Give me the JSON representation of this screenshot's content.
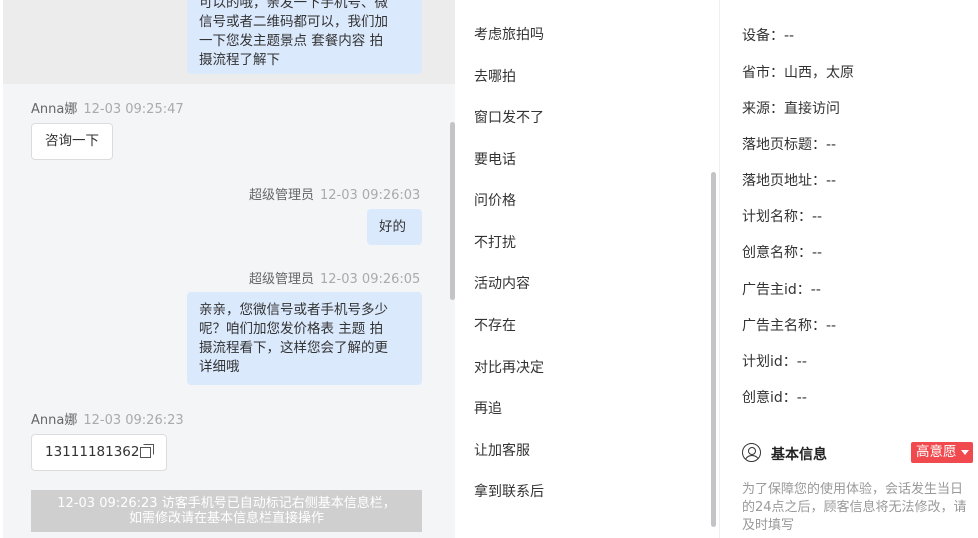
{
  "chat": {
    "messages": [
      {
        "role": "agent",
        "lines": [
          "可以的哦，亲发一下手机号、微",
          "信号或者二维码都可以，我们加",
          "一下您发主题景点 套餐内容 拍",
          "摄流程了解下"
        ]
      },
      {
        "role": "visitor",
        "name": "Anna娜",
        "time": "12-03 09:25:47",
        "text": "咨询一下"
      },
      {
        "role": "agent",
        "name": "超级管理员",
        "time": "12-03 09:26:03",
        "lines": [
          "好的"
        ]
      },
      {
        "role": "agent",
        "name": "超级管理员",
        "time": "12-03 09:26:05",
        "lines": [
          "亲亲，您微信号或者手机号多少",
          "呢？咱们加您发价格表 主题 拍",
          "摄流程看下，这样您会了解的更",
          "详细哦"
        ]
      },
      {
        "role": "visitor",
        "name": "Anna娜",
        "time": "12-03 09:26:23",
        "text": "13111181362"
      }
    ],
    "system_notice": [
      "12-03 09:26:23 访客手机号已自动标记右侧基本信息栏，",
      "如需修改请在基本信息栏直接操作"
    ]
  },
  "quick_phrases": [
    "考虑旅拍吗",
    "去哪拍",
    "窗口发不了",
    "要电话",
    "问价格",
    "不打扰",
    "活动内容",
    "不存在",
    "对比再决定",
    "再追",
    "让加客服",
    "拿到联系后"
  ],
  "info": {
    "rows": [
      "设备：--",
      "省市：山西，太原",
      "来源：直接访问",
      "落地页标题：--",
      "落地页地址：--",
      "计划名称：--",
      "创意名称：--",
      "广告主id：--",
      "广告主名称：--",
      "计划id：--",
      "创意id：--"
    ],
    "section_title": "基本信息",
    "intent_label": "高意愿",
    "notice": "为了保障您的使用体验，会话发生当日的24点之后，顾客信息将无法修改，请及时填写"
  },
  "colors": {
    "agent_bubble": "#dbe9fd",
    "intent_badge": "#f04a4f"
  }
}
